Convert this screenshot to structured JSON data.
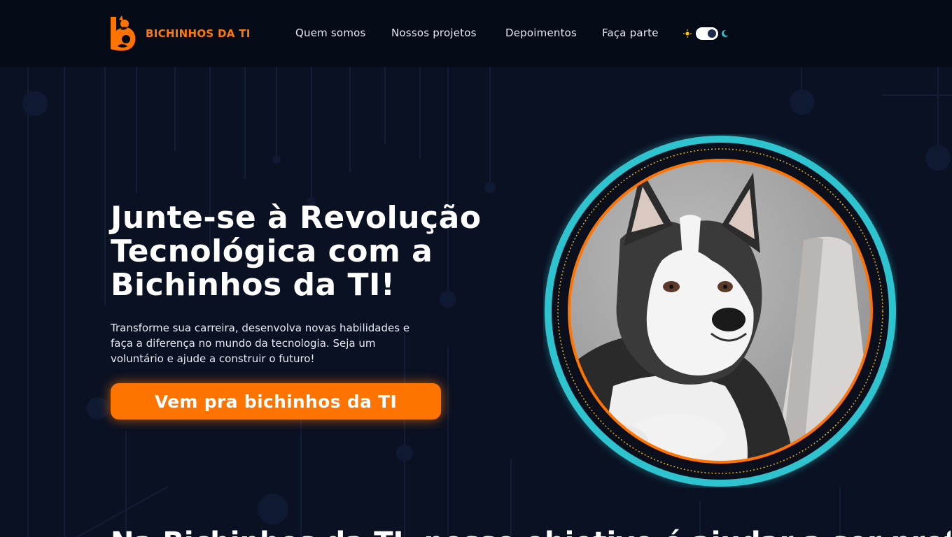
{
  "brand": {
    "name": "BICHINHOS DA TI"
  },
  "nav": {
    "links": [
      "Quem somos",
      "Nossos projetos",
      "Depoimentos",
      "Faça parte"
    ],
    "theme_toggle": {
      "light_icon": "sun-icon",
      "dark_icon": "moon-icon",
      "state": "dark"
    }
  },
  "hero": {
    "title_lines": [
      "Junte-se à Revolução",
      "Tecnológica com a",
      "Bichinhos da TI!"
    ],
    "subtitle_lines": [
      "Transforme sua carreira, desenvolva novas habilidades e",
      "faça a diferença no mundo da tecnologia. Seja um",
      "voluntário e ajude a construir o futuro!"
    ],
    "cta_label": "Vem pra bichinhos da TI",
    "image_subject": "husky dog looking at a laptop"
  },
  "next_section": {
    "heading_partial": "Na Bichinhos da TI, nosso objetivo é ajudar a ser profissionais na transição"
  },
  "colors": {
    "background": "#0a1122",
    "navbar": "#050a17",
    "accent": "#ff7300",
    "ring": "#2ec4cf",
    "text": "#ffffff"
  }
}
